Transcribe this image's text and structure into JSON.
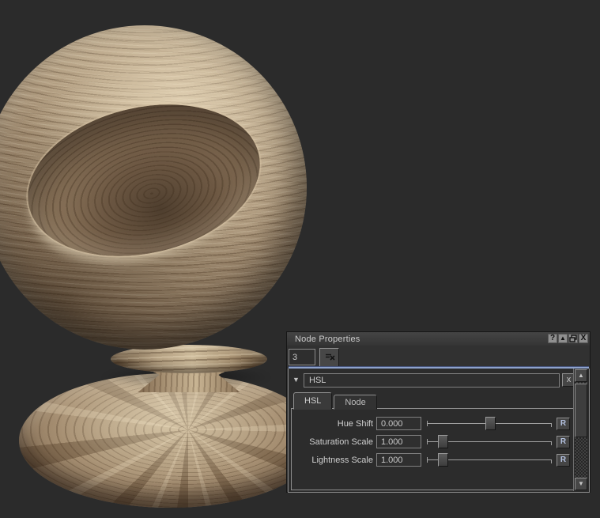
{
  "scene": {
    "object": "material-preview-sphere",
    "material": "wood",
    "wood_colors": {
      "light": "#cdbb9b",
      "base": "#ab967a",
      "dark": "#6d5840",
      "ring": "#4e3e2e"
    },
    "background_color": "#2b2b2b"
  },
  "panel": {
    "title": "Node Properties",
    "titlebar_icons": {
      "help": "?",
      "collapse": "▲",
      "restore": "restore-window",
      "close": "X"
    },
    "node_index": {
      "value": "3"
    },
    "detach_button": {
      "icon": "detach-node"
    },
    "node": {
      "header": {
        "collapse_icon": "▼",
        "title": "HSL",
        "remove_label": "x"
      },
      "tabs": [
        {
          "label": "HSL",
          "active": true
        },
        {
          "label": "Node",
          "active": false
        }
      ],
      "rows": [
        {
          "label": "Hue Shift",
          "value": "0.000",
          "thumb_left": "47%",
          "reset_label": "R"
        },
        {
          "label": "Saturation Scale",
          "value": "1.000",
          "thumb_left": "9%",
          "reset_label": "R"
        },
        {
          "label": "Lightness Scale",
          "value": "1.000",
          "thumb_left": "9%",
          "reset_label": "R"
        }
      ]
    },
    "scrollbar": {
      "up_icon": "▲",
      "down_icon": "▼"
    },
    "colors": {
      "titlebar": "#3c3c3c",
      "body": "#313131",
      "selection_accent": "#8ea2cc",
      "reset_text": "#b3c1e0"
    }
  }
}
